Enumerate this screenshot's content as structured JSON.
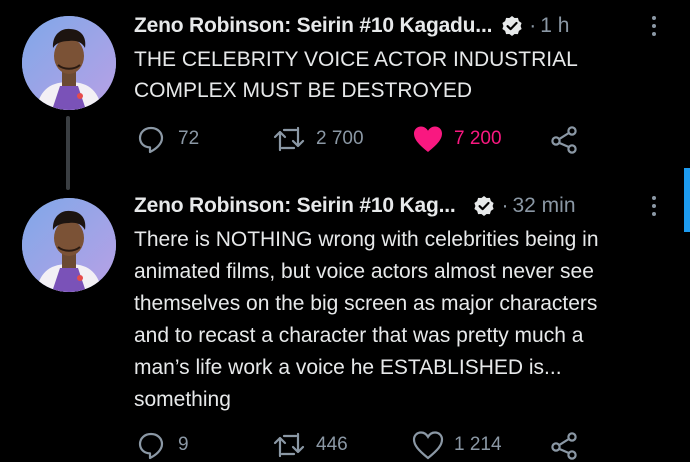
{
  "tweets": [
    {
      "author": "Zeno Robinson: Seirin #10 Kagadu...",
      "time": "1 h",
      "text": "THE CELEBRITY VOICE ACTOR INDUSTRIAL\nCOMPLEX MUST BE DESTROYED",
      "replies": "72",
      "retweets": "2 700",
      "likes": "7 200",
      "liked": true
    },
    {
      "author": "Zeno Robinson: Seirin #10 Kag...",
      "time": "32 min",
      "text": "There is NOTHING wrong with celebrities being in\nanimated films, but voice actors almost never see\nthemselves on the big screen as major characters\nand to recast a character that was pretty much a\nman’s life work a voice he ESTABLISHED is...\nsomething",
      "replies": "9",
      "retweets": "446",
      "likes": "1 214",
      "liked": false
    }
  ],
  "icons": {
    "reply": "reply-icon",
    "retweet": "retweet-icon",
    "like": "like-icon",
    "share": "share-icon",
    "verified": "verified-badge-icon",
    "more": "more-icon"
  },
  "colors": {
    "background": "#000000",
    "text": "#e7e9ea",
    "muted": "#8b98a5",
    "like_active": "#f91880",
    "accent": "#1d9bf0"
  }
}
